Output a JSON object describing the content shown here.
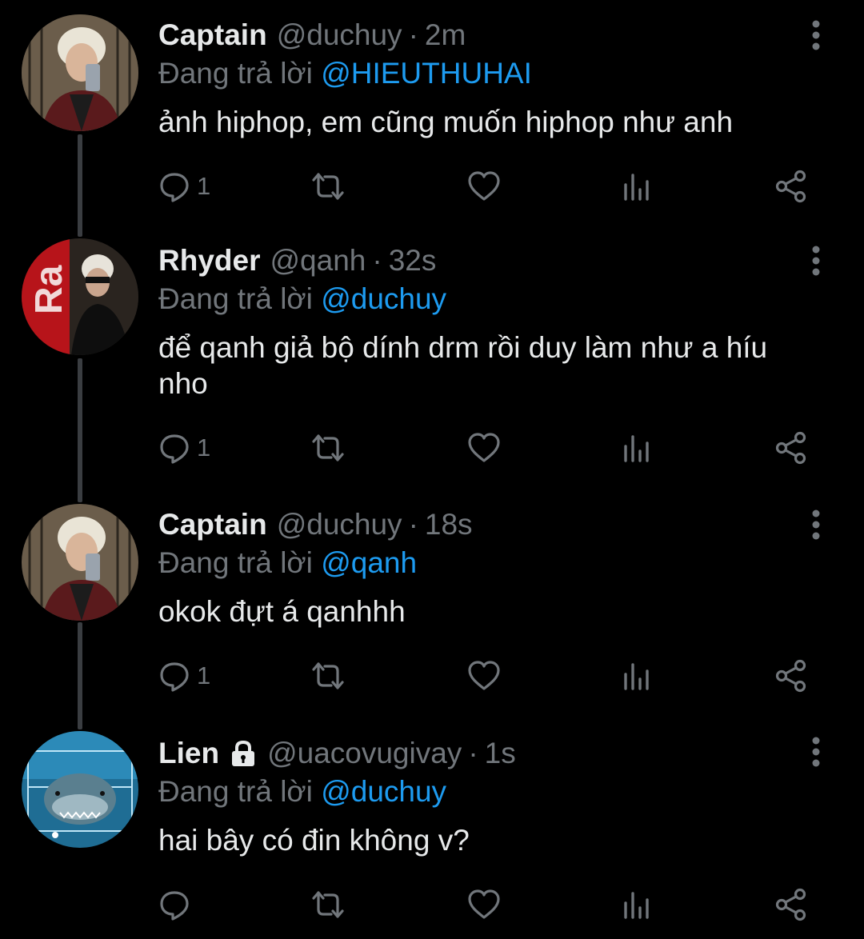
{
  "tweets": [
    {
      "display_name": "Captain",
      "handle": "@duchuy",
      "separator": "·",
      "time": "2m",
      "reply_prefix": "Đang trả lời",
      "reply_to": "@HIEUTHUHAI",
      "text": "ảnh hiphop, em cũng muốn hiphop như anh",
      "reply_count": "1",
      "avatar": "avatar-captain"
    },
    {
      "display_name": "Rhyder",
      "handle": "@qanh",
      "separator": "·",
      "time": "32s",
      "reply_prefix": "Đang trả lời",
      "reply_to": "@duchuy",
      "text": "để qanh giả bộ dính drm rồi duy làm như a híu nho",
      "reply_count": "1",
      "avatar": "avatar-rhyder"
    },
    {
      "display_name": "Captain",
      "handle": "@duchuy",
      "separator": "·",
      "time": "18s",
      "reply_prefix": "Đang trả lời",
      "reply_to": "@qanh",
      "text": "okok đựt á qanhhh",
      "reply_count": "1",
      "avatar": "avatar-captain"
    },
    {
      "display_name": "Lien",
      "handle": "@uacovugivay",
      "separator": "·",
      "time": "1s",
      "reply_prefix": "Đang trả lời",
      "reply_to": "@duchuy",
      "text": "hai bây có đin không v?",
      "reply_count": "",
      "avatar": "avatar-lien",
      "protected": true
    }
  ],
  "icons": {
    "reply": "reply-icon",
    "retweet": "retweet-icon",
    "like": "heart-icon",
    "views": "views-icon",
    "share": "share-icon",
    "more": "more-icon",
    "lock": "lock-icon"
  },
  "colors": {
    "background": "#000000",
    "primary_text": "#e7e9ea",
    "secondary_text": "#71767b",
    "link": "#1d9bf0",
    "thread_line": "#3a3d41"
  }
}
